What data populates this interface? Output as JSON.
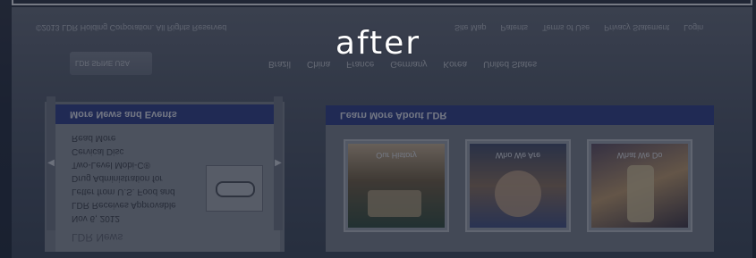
{
  "overlay": {
    "headline": "after"
  },
  "page": {
    "copyright": "©2013 LDR Holding Corporation. All Rights Reserved",
    "top_links": [
      "Site Map",
      "Patents",
      "Terms of Use",
      "Privacy Statement",
      "Login"
    ],
    "logo_text": "LDR SPINE USA",
    "nav_items": [
      "Brazil",
      "China",
      "France",
      "Germany",
      "Korea",
      "United States"
    ],
    "left_panel": {
      "title": "More News and Events",
      "read_more": "Read More",
      "news_lines": [
        "Cervical Disc",
        "Two-Level Mobi-C®",
        "Drug Administration for",
        "Letter from U.S. Food and",
        "LDR Receives Approvable",
        "Nov 6, 2012"
      ],
      "news_title": "LDR News"
    },
    "right_panel": {
      "title": "Learn More About LDR",
      "cards": [
        {
          "caption": "Our History"
        },
        {
          "caption": "Who We Are"
        },
        {
          "caption": "What We Do"
        }
      ]
    }
  }
}
